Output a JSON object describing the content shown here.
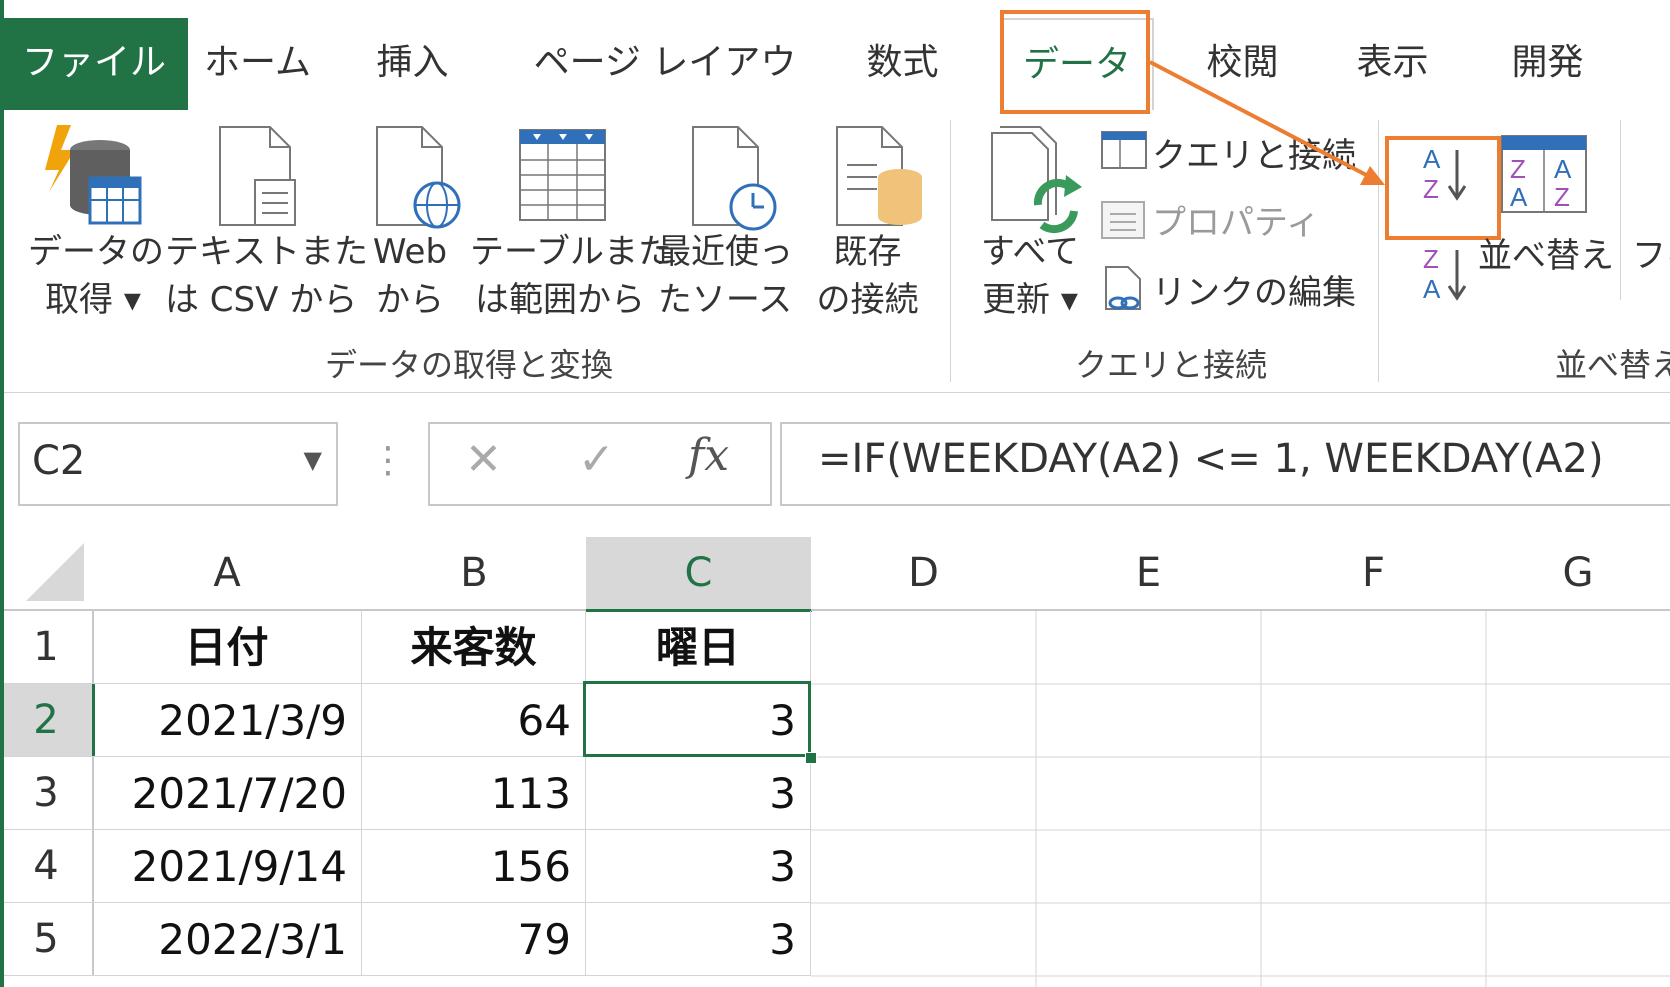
{
  "tabs": [
    "ファイル",
    "ホーム",
    "挿入",
    "ページ レイアウト",
    "数式",
    "データ",
    "校閲",
    "表示",
    "開発"
  ],
  "ribbon": {
    "get_data": {
      "line1": "データの",
      "line2": "取得 ▾"
    },
    "text_csv": {
      "line1": "テキストまた",
      "line2": "は CSV から"
    },
    "web": {
      "line1": "Web",
      "line2": "から"
    },
    "table_range": {
      "line1": "テーブルまた",
      "line2": "は範囲から"
    },
    "recent_sources": {
      "line1": "最近使っ",
      "line2": "たソース"
    },
    "existing_conn": {
      "line1": "既存",
      "line2": "の接続"
    },
    "group_get_transform": "データの取得と変換",
    "refresh_all": {
      "line1": "すべて",
      "line2": "更新 ▾"
    },
    "queries_connections": "クエリと接続",
    "properties": "プロパティ",
    "edit_links": "リンクの編集",
    "group_queries": "クエリと接続",
    "sort": "並べ替え",
    "filter": "フィ",
    "group_sort": "並べ替え"
  },
  "formula_bar": {
    "name_box": "C2",
    "formula": "=IF(WEEKDAY(A2) <= 1, WEEKDAY(A2)"
  },
  "sheet": {
    "columns": [
      "A",
      "B",
      "C",
      "D",
      "E",
      "F",
      "G"
    ],
    "rows": [
      "1",
      "2",
      "3",
      "4",
      "5"
    ],
    "headers": [
      "日付",
      "来客数",
      "曜日"
    ],
    "data": [
      [
        "2021/3/9",
        "64",
        "3"
      ],
      [
        "2021/7/20",
        "113",
        "3"
      ],
      [
        "2021/9/14",
        "156",
        "3"
      ],
      [
        "2022/3/1",
        "79",
        "3"
      ]
    ]
  },
  "colors": {
    "excel_green": "#217346",
    "highlight_orange": "#ED7D31"
  }
}
